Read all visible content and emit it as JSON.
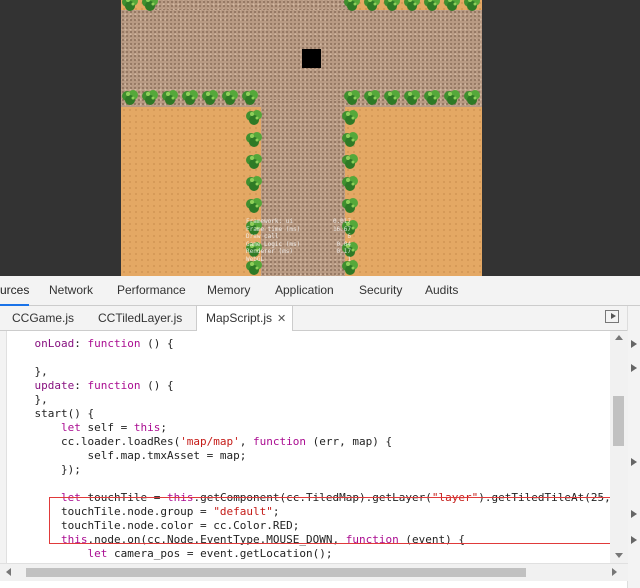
{
  "devtools": {
    "panel_tabs": [
      "urces",
      "Network",
      "Performance",
      "Memory",
      "Application",
      "Security",
      "Audits"
    ],
    "active_panel": "urces",
    "file_tabs": [
      "CCGame.js",
      "CCTiledLayer.js",
      "MapScript.js"
    ],
    "active_file": "MapScript.js",
    "close_glyph": "✕"
  },
  "game": {
    "stats": [
      {
        "label": "Framework: ui",
        "value": "0.017"
      },
      {
        "label": "Frame time (ms)",
        "value": "16.67"
      },
      {
        "label": "Draw call",
        "value": "6"
      },
      {
        "label": "Game Logic (ms)",
        "value": "0.04"
      },
      {
        "label": "Renderer (ms)",
        "value": "0.17"
      },
      {
        "label": "WebGL",
        "value": "1"
      }
    ]
  },
  "editor": {
    "lines": [
      {
        "n": "",
        "text": ""
      },
      {
        "n": "",
        "text": "    onLoad: function () {"
      },
      {
        "n": "",
        "text": ""
      },
      {
        "n": "",
        "text": "    },"
      },
      {
        "n": "",
        "text": "    update: function () {"
      },
      {
        "n": "",
        "text": "    },"
      },
      {
        "n": "",
        "text": "    start() {"
      },
      {
        "n": "",
        "text": "        let self = this;"
      },
      {
        "n": "",
        "text": "        cc.loader.loadRes('map/map', function (err, map) {"
      },
      {
        "n": "",
        "text": "            self.map.tmxAsset = map;"
      },
      {
        "n": "",
        "text": "        });"
      },
      {
        "n": "",
        "text": ""
      },
      {
        "n": "",
        "text": "        let touchTile = this.getComponent(cc.TiledMap).getLayer(\"layer\").getTiledTileAt(25,"
      },
      {
        "n": "",
        "text": "        touchTile.node.group = \"default\";"
      },
      {
        "n": "",
        "text": "        touchTile.node.color = cc.Color.RED;"
      },
      {
        "n": "",
        "text": "        this.node.on(cc.Node.EventType.MOUSE_DOWN, function (event) {"
      },
      {
        "n": "",
        "text": "            let camera_pos = event.getLocation();"
      }
    ]
  },
  "colors": {
    "accent": "#1a73e8",
    "highlight_border": "#e03a3a",
    "sand": "#e4a864",
    "road": "#b89a83"
  }
}
